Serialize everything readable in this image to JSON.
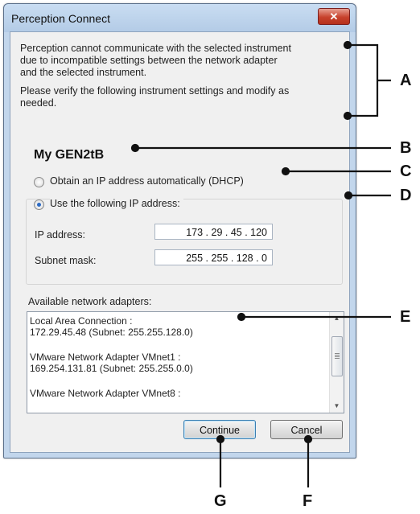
{
  "window": {
    "title": "Perception Connect",
    "close_symbol": "✕"
  },
  "message": {
    "line1": "Perception cannot communicate with the selected instrument",
    "line2": "due to incompatible settings between the network adapter",
    "line3": "and the selected instrument.",
    "line4": "Please verify the following instrument settings and modify as",
    "line5": "needed."
  },
  "instrument_name": "My GEN2tB",
  "ip_mode": {
    "dhcp_label": "Obtain an IP address automatically (DHCP)",
    "static_label": "Use the following IP address:",
    "selected": "static"
  },
  "ip_fields": {
    "ip_label": "IP address:",
    "ip_value": "173 .  29  .  45  . 120",
    "mask_label": "Subnet mask:",
    "mask_value": "255 . 255 . 128 .   0"
  },
  "adapters": {
    "label": "Available network adapters:",
    "items": [
      {
        "name": "Local Area Connection :",
        "detail": "172.29.45.48 (Subnet: 255.255.128.0)"
      },
      {
        "name": "VMware Network Adapter VMnet1 :",
        "detail": "169.254.131.81 (Subnet: 255.255.0.0)"
      },
      {
        "name": "VMware Network Adapter VMnet8 :",
        "detail": ""
      }
    ],
    "scroll_up": "▲",
    "scroll_down": "▼"
  },
  "buttons": {
    "continue": "Continue",
    "cancel": "Cancel"
  },
  "callouts": {
    "a": "A",
    "b": "B",
    "c": "C",
    "d": "D",
    "e": "E",
    "f": "F",
    "g": "G"
  }
}
